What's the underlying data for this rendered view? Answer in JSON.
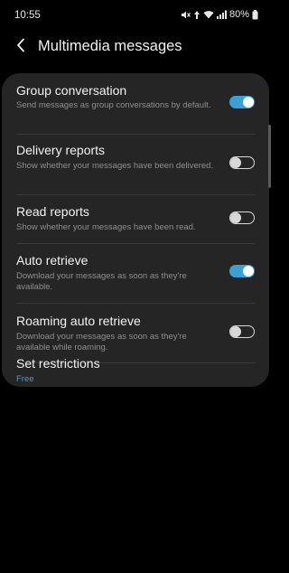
{
  "status_bar": {
    "time": "10:55",
    "battery": "80%"
  },
  "header": {
    "title": "Multimedia messages"
  },
  "settings": [
    {
      "label": "Group conversation",
      "description": "Send messages as group conversations by default.",
      "toggle": "on"
    },
    {
      "label": "Delivery reports",
      "description": "Show whether your messages have been delivered.",
      "toggle": "off"
    },
    {
      "label": "Read reports",
      "description": "Show whether your messages have been read.",
      "toggle": "off"
    },
    {
      "label": "Auto retrieve",
      "description": "Download your messages as soon as they're available.",
      "toggle": "on"
    },
    {
      "label": "Roaming auto retrieve",
      "description": "Download your messages as soon as they're available while roaming.",
      "toggle": "off"
    },
    {
      "label": "Set restrictions",
      "value": "Free"
    }
  ],
  "colors": {
    "accent": "#3aa0d8",
    "card_background": "#252525",
    "page_background": "#000000"
  }
}
